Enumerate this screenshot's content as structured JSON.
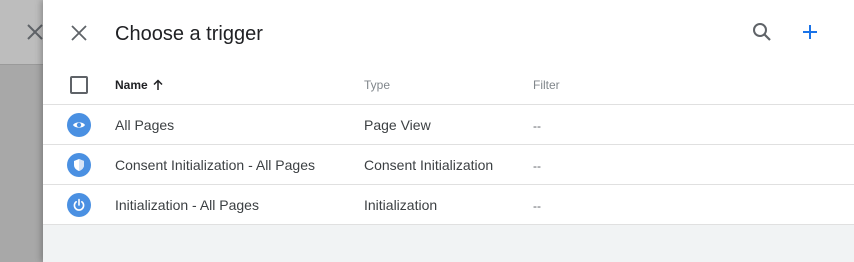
{
  "header": {
    "title": "Choose a trigger"
  },
  "columns": {
    "name": "Name",
    "type": "Type",
    "filter": "Filter"
  },
  "rows": [
    {
      "name": "All Pages",
      "type": "Page View",
      "filter": "--",
      "icon": "eye-icon"
    },
    {
      "name": "Consent Initialization - All Pages",
      "type": "Consent Initialization",
      "filter": "--",
      "icon": "shield-icon"
    },
    {
      "name": "Initialization - All Pages",
      "type": "Initialization",
      "filter": "--",
      "icon": "power-icon"
    }
  ],
  "colors": {
    "accent": "#1a73e8",
    "row_icon_bg": "#4a90e2"
  }
}
